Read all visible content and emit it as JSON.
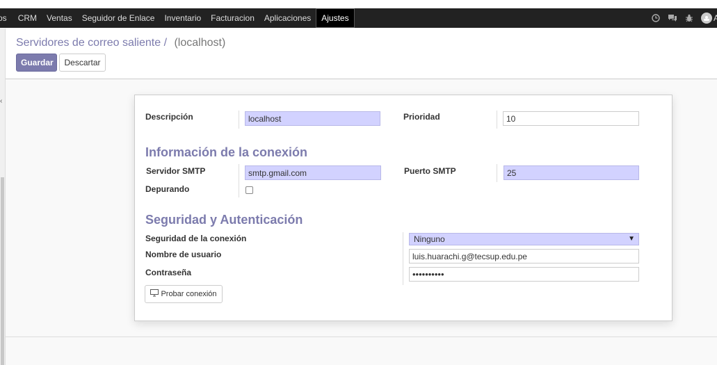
{
  "topbar": {
    "menu": [
      {
        "label": "os",
        "active": false
      },
      {
        "label": "CRM",
        "active": false
      },
      {
        "label": "Ventas",
        "active": false
      },
      {
        "label": "Seguidor de Enlace",
        "active": false
      },
      {
        "label": "Inventario",
        "active": false
      },
      {
        "label": "Facturacion",
        "active": false
      },
      {
        "label": "Aplicaciones",
        "active": false
      },
      {
        "label": "Ajustes",
        "active": true
      }
    ],
    "icons": [
      "clock-icon",
      "chat-icon",
      "bug-icon"
    ],
    "avatar_letter": "A"
  },
  "breadcrumb": {
    "parent": "Servidores de correo saliente",
    "separator": "/",
    "current": "(localhost)"
  },
  "buttons": {
    "save": "Guardar",
    "discard": "Descartar",
    "test_connection": "Probar conexión"
  },
  "form": {
    "description": {
      "label": "Descripción",
      "value": "localhost"
    },
    "priority": {
      "label": "Prioridad",
      "value": "10"
    },
    "connection_section": "Información de la conexión",
    "smtp_server": {
      "label": "Servidor SMTP",
      "value": "smtp.gmail.com"
    },
    "smtp_port": {
      "label": "Puerto SMTP",
      "value": "25"
    },
    "debugging": {
      "label": "Depurando",
      "checked": false
    },
    "security_section": "Seguridad y Autenticación",
    "connection_security": {
      "label": "Seguridad de la conexión",
      "value": "Ninguno"
    },
    "username": {
      "label": "Nombre de usuario",
      "value": "luis.huarachi.g@tecsup.edu.pe"
    },
    "password": {
      "label": "Contraseña",
      "value": "••••••••••"
    }
  },
  "colors": {
    "brand": "#7c7bad",
    "required_field": "#d2d2ff",
    "topbar": "#222222"
  }
}
